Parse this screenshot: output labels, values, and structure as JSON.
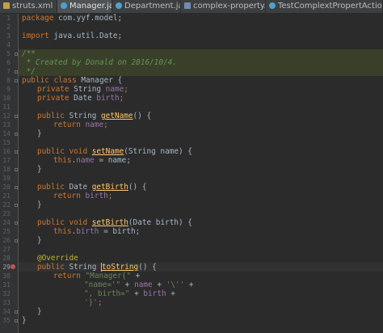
{
  "tabs": [
    {
      "label": "struts.xml",
      "icon": "xml-file-icon",
      "active": false
    },
    {
      "label": "Manager.java",
      "icon": "class-file-icon",
      "active": true
    },
    {
      "label": "Department.java",
      "icon": "class-file-icon",
      "active": false
    },
    {
      "label": "complex-property.jsp",
      "icon": "jsp-file-icon",
      "active": false
    },
    {
      "label": "TestComplextPropertAction.java",
      "icon": "class-file-icon",
      "active": false
    }
  ],
  "close_glyph": "×",
  "current_line": 29,
  "override_marker_line": 29,
  "colors": {
    "keyword": "#cc7832",
    "field": "#9876aa",
    "string": "#6a8759",
    "doc_comment": "#629755",
    "annotation": "#bbb529",
    "method_declaration": "#ffc66d",
    "default_text": "#a9b7c6",
    "background": "#2b2b2b",
    "gutter": "#313335"
  },
  "code": {
    "l1_kw": "package",
    "l1_rest": " com.yyf.model;",
    "l3_kw": "import",
    "l3_rest": " java.util.Date;",
    "l5": "/**",
    "l6": " * Created by Donald on 2016/10/4.",
    "l7": " */",
    "l8_kw": "public class",
    "l8_rest": " Manager {",
    "l9_kw": "private",
    "l9_type": " String ",
    "l9_field": "name",
    "l9_end": ";",
    "l10_kw": "private",
    "l10_type": " Date ",
    "l10_field": "birth",
    "l10_end": ";",
    "l12_kw": "public",
    "l12_type": " String ",
    "l12_method": "getName",
    "l12_end": "() {",
    "l13_kw": "return",
    "l13_sp": " ",
    "l13_field": "name",
    "l13_end": ";",
    "l14": "}",
    "l16_kw": "public void",
    "l16_sp": " ",
    "l16_method": "setName",
    "l16_end": "(String name) {",
    "l17_kw": "this",
    "l17_dot": ".",
    "l17_field": "name",
    "l17_end": " = name;",
    "l18": "}",
    "l20_kw": "public",
    "l20_type": " Date ",
    "l20_method": "getBirth",
    "l20_end": "() {",
    "l21_kw": "return",
    "l21_sp": " ",
    "l21_field": "birth",
    "l21_end": ";",
    "l22": "}",
    "l24_kw": "public void",
    "l24_sp": " ",
    "l24_method": "setBirth",
    "l24_end": "(Date birth) {",
    "l25_kw": "this",
    "l25_dot": ".",
    "l25_field": "birth",
    "l25_end": " = birth;",
    "l26": "}",
    "l28": "@Override",
    "l29_kw": "public",
    "l29_type": " String ",
    "l29_method": "toString",
    "l29_end": "() {",
    "l30_kw": "return",
    "l30_sp": " ",
    "l30_str": "\"Manager{\"",
    "l30_end": " +",
    "l31_str1": "\"name='\"",
    "l31_mid1": " + ",
    "l31_field": "name",
    "l31_mid2": " + ",
    "l31_str2": "'\\''",
    "l31_end": " +",
    "l32_str": "\", birth=\"",
    "l32_mid": " + ",
    "l32_field": "birth",
    "l32_end": " +",
    "l33_str": "'}'",
    "l33_end": ";",
    "l34": "}",
    "l35": "}"
  }
}
